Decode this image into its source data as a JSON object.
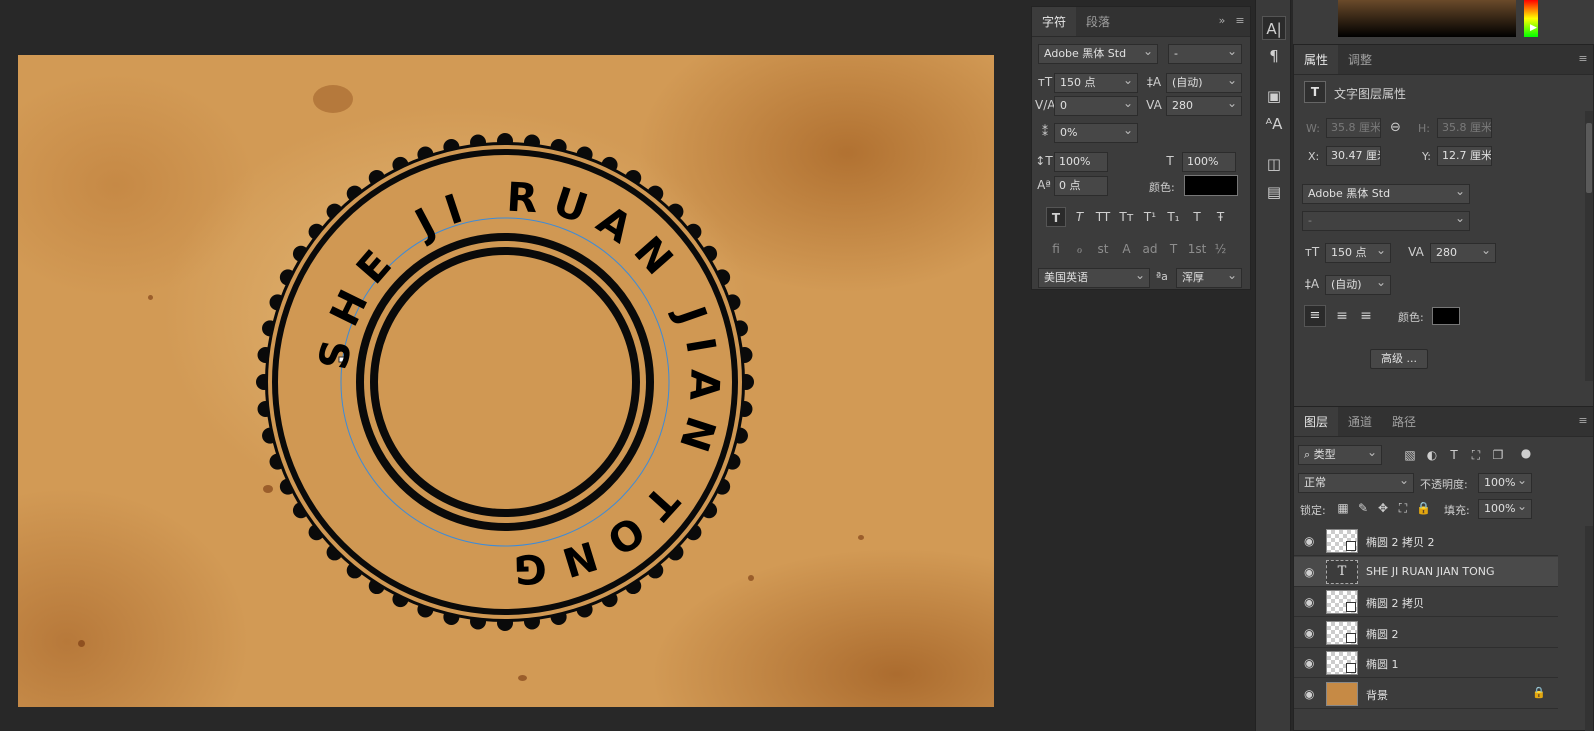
{
  "canvas": {
    "stamp_text": "SHE JI RUAN JIAN TONG"
  },
  "character_panel": {
    "tabs": [
      "字符",
      "段落"
    ],
    "font_family": "Adobe 黑体 Std",
    "font_style": "-",
    "font_size": "150 点",
    "leading": "(自动)",
    "kerning": "0",
    "tracking": "280",
    "tsume": "0%",
    "vertical_scale": "100%",
    "horizontal_scale": "100%",
    "baseline_shift": "0 点",
    "color_label": "颜色:",
    "style_buttons": [
      "T",
      "T",
      "TT",
      "Tт",
      "T¹",
      "T₁",
      "T",
      "Ŧ"
    ],
    "opentype_buttons": [
      "ﬁ",
      "ℴ",
      "st",
      "A",
      "ad",
      "T",
      "1st",
      "½"
    ],
    "language": "美国英语",
    "aa_label": "ªa",
    "antialias": "浑厚"
  },
  "properties_panel": {
    "tabs": [
      "属性",
      "调整"
    ],
    "header": "文字图层属性",
    "w_label": "W:",
    "w_value": "35.8 厘米",
    "link_icon": "⊖",
    "h_label": "H:",
    "h_value": "35.8 厘米",
    "x_label": "X:",
    "x_value": "30.47 厘米",
    "y_label": "Y:",
    "y_value": "12.7 厘米",
    "font_family": "Adobe 黑体 Std",
    "font_style": "-",
    "font_size": "150 点",
    "tracking": "280",
    "leading": "(自动)",
    "color_label": "颜色:",
    "advanced_button": "高级 ..."
  },
  "layers_panel": {
    "tabs": [
      "图层",
      "通道",
      "路径"
    ],
    "filter_kind": "类型",
    "blend_mode": "正常",
    "opacity_label": "不透明度:",
    "opacity_value": "100%",
    "lock_label": "锁定:",
    "fill_label": "填充:",
    "fill_value": "100%",
    "layers": [
      {
        "name": "椭圆 2 拷贝 2",
        "kind": "shape"
      },
      {
        "name": "SHE JI RUAN JIAN TONG",
        "kind": "text"
      },
      {
        "name": "椭圆 2 拷贝",
        "kind": "shape"
      },
      {
        "name": "椭圆 2",
        "kind": "shape"
      },
      {
        "name": "椭圆 1",
        "kind": "shape"
      },
      {
        "name": "背景",
        "kind": "background"
      }
    ]
  },
  "colors": {
    "text_color": "#000000",
    "ui_bg": "#282828",
    "panel_bg": "#3c3c3c"
  }
}
